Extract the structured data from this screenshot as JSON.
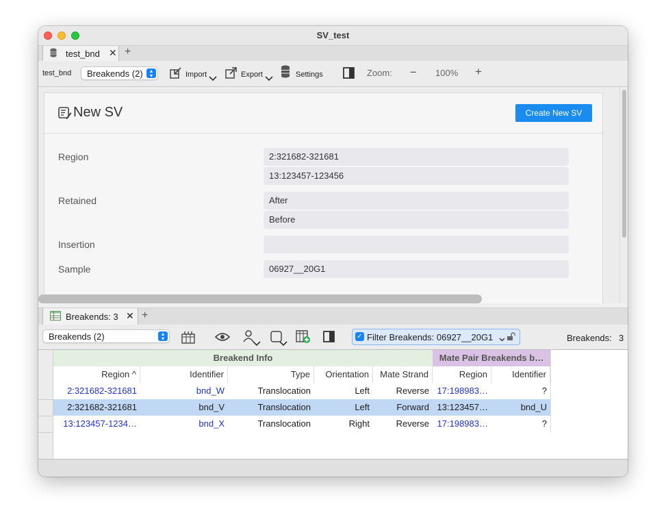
{
  "window": {
    "title": "SV_test"
  },
  "doc_tab": {
    "label": "test_bnd",
    "icon": "database-icon"
  },
  "toolbar": {
    "db_label": "test_bnd",
    "view_select": "Breakends (2)",
    "import_label": "Import",
    "export_label": "Export",
    "settings_label": "Settings",
    "zoom_label": "Zoom:",
    "zoom_value": "100%",
    "zoom_minus": "−",
    "zoom_plus": "+"
  },
  "form": {
    "title": "New SV",
    "create_button": "Create New SV",
    "fields": [
      {
        "label": "Region",
        "values": [
          "2:321682-321681",
          "13:123457-123456"
        ]
      },
      {
        "label": "Retained",
        "values": [
          "After",
          "Before"
        ]
      },
      {
        "label": "Insertion",
        "values": [
          ""
        ]
      },
      {
        "label": "Sample",
        "values": [
          "06927__20G1"
        ]
      }
    ]
  },
  "bottom_tab": {
    "label": "Breakends: 3",
    "icon": "table-icon"
  },
  "bottom_toolbar": {
    "view_select": "Breakends (2)",
    "filter_checked": true,
    "filter_text": "Filter Breakends: 06927__20G1",
    "count_label": "Breakends:",
    "count_value": "3"
  },
  "table": {
    "groups": [
      "Breakend Info",
      "Mate Pair Breakends b…"
    ],
    "columns": [
      "Region ^",
      "Identifier",
      "Type",
      "Orientation",
      "Mate Strand",
      "Region",
      "Identifier"
    ],
    "rows": [
      [
        "2:321682-321681",
        "bnd_W",
        "Translocation",
        "Left",
        "Reverse",
        "17:198983…",
        "?"
      ],
      [
        "2:321682-321681",
        "bnd_V",
        "Translocation",
        "Left",
        "Forward",
        "13:123457…",
        "bnd_U"
      ],
      [
        "13:123457-1234…",
        "bnd_X",
        "Translocation",
        "Right",
        "Reverse",
        "17:198983…",
        "?"
      ]
    ],
    "selected_row": 1
  }
}
